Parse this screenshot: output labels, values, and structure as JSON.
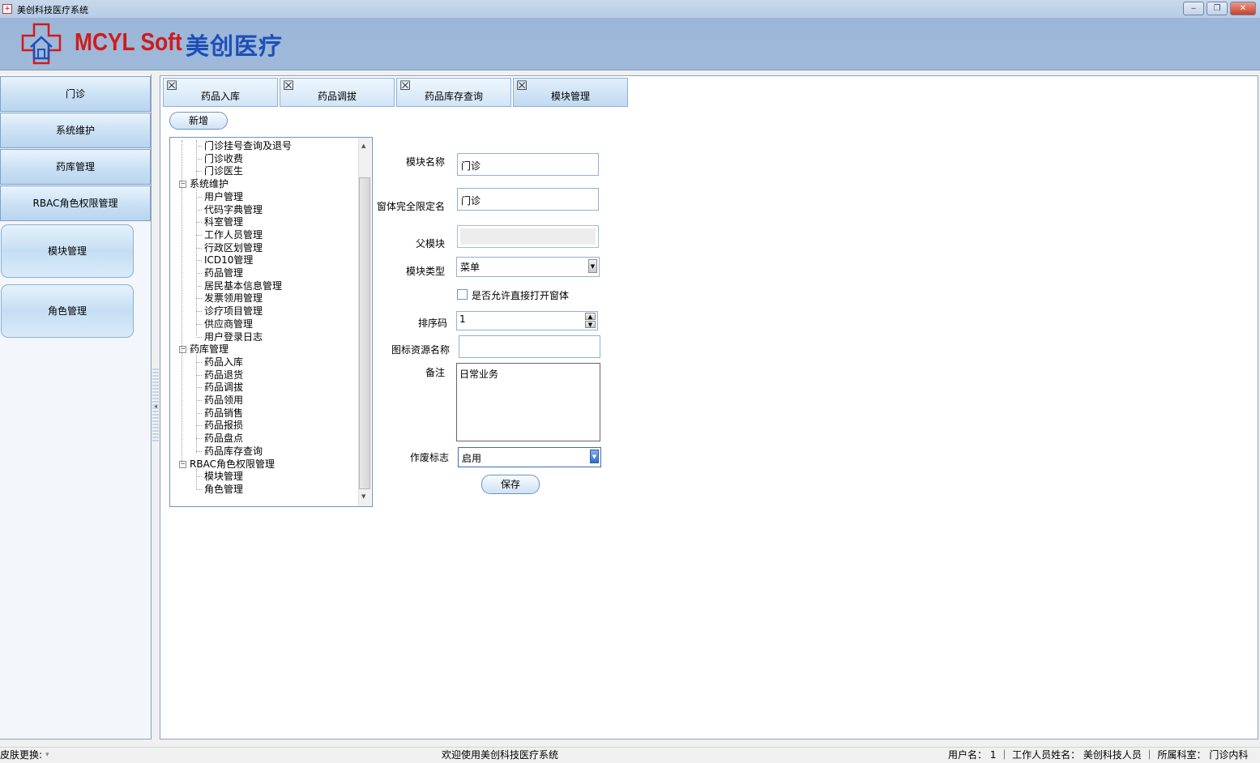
{
  "window": {
    "title": "美创科技医疗系统",
    "controls": {
      "minimize": "‒",
      "restore": "❐",
      "close": "✕"
    }
  },
  "banner": {
    "brand_en": "MCYL Soft",
    "brand_cn": "美创医疗"
  },
  "nav": {
    "groups": [
      "门诊",
      "系统维护",
      "药库管理",
      "RBAC角色权限管理"
    ],
    "items": [
      "模块管理",
      "角色管理"
    ]
  },
  "tabs": [
    {
      "label": "药品入库",
      "active": false
    },
    {
      "label": "药品调拔",
      "active": false
    },
    {
      "label": "药品库存查询",
      "active": false
    },
    {
      "label": "模块管理",
      "active": true
    }
  ],
  "toolbar": {
    "add_label": "新增"
  },
  "tree": {
    "nodes": [
      "门诊挂号查询及退号",
      "门诊收费",
      "门诊医生",
      "系统维护",
      "用户管理",
      "代码字典管理",
      "科室管理",
      "工作人员管理",
      "行政区划管理",
      "ICD10管理",
      "药品管理",
      "居民基本信息管理",
      "发票领用管理",
      "诊疗项目管理",
      "供应商管理",
      "用户登录日志",
      "药库管理",
      "药品入库",
      "药品退货",
      "药品调拔",
      "药品领用",
      "药品销售",
      "药品报损",
      "药品盘点",
      "药品库存查询",
      "RBAC角色权限管理",
      "模块管理",
      "角色管理"
    ]
  },
  "form": {
    "module_name_label": "模块名称",
    "module_name_value": "门诊",
    "form_qualified_label": "窗体完全限定名",
    "form_qualified_value": "门诊",
    "parent_label": "父模块",
    "parent_value": "",
    "type_label": "模块类型",
    "type_value": "菜单",
    "allow_open_label": "是否允许直接打开窗体",
    "allow_open_checked": false,
    "sort_label": "排序码",
    "sort_value": "1",
    "icon_label": "图标资源名称",
    "icon_value": "",
    "remark_label": "备注",
    "remark_value": "日常业务",
    "status_label": "作废标志",
    "status_value": "启用",
    "save_label": "保存"
  },
  "statusbar": {
    "skin_label": "皮肤更换:",
    "welcome": "欢迎使用美创科技医疗系统",
    "user_info": "用户名： 1 ｜ 工作人员姓名： 美创科技人员 ｜ 所属科室： 门诊内科"
  },
  "colors": {
    "brand_en": "#cf1b1b",
    "brand_cn": "#1d4fb8",
    "banner": "#9fb9d9"
  }
}
